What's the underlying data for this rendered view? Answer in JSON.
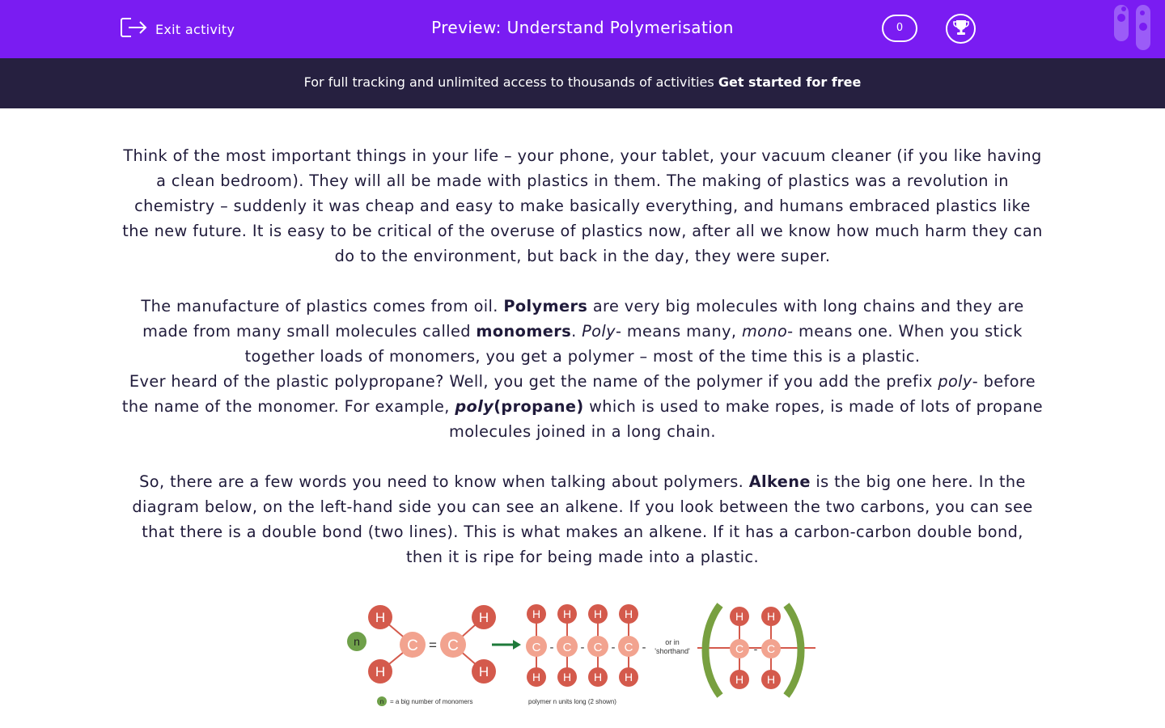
{
  "header": {
    "exit_label": "Exit activity",
    "title": "Preview: Understand Polymerisation",
    "score": "0",
    "bg_color": "#7a1cf2"
  },
  "banner": {
    "text": "For full tracking and unlimited access to thousands of activities ",
    "cta": "Get started for free"
  },
  "content": {
    "p1": "Think of the most important things in your life – your phone, your tablet, your vacuum cleaner (if you like having a clean bedroom). They will all be made with plastics in them. The making of plastics was a revolution in chemistry – suddenly it was cheap and easy to make basically everything, and humans embraced plastics like the new future. It is easy to be critical of the overuse of plastics now, after all we know how much harm they can do to the environment, but back in the day, they were super.",
    "p2": {
      "t1": "The manufacture of plastics comes from oil. ",
      "b1": "Polymers",
      "t2": " are very big molecules with long chains and they are made from many small molecules called ",
      "b2": "monomers",
      "t3": ". ",
      "i1": "Poly",
      "t4": "- means many, ",
      "i2": "mono",
      "t5": "- means one. When you stick together loads of monomers, you get a polymer – most of the time this is a plastic."
    },
    "p3": {
      "t1": "Ever heard of the plastic polypropane? Well, you get the name of the polymer if you add the prefix ",
      "i1": "poly",
      "t2": "- before the name of the monomer. For example, ",
      "bi1": "poly",
      "b1": "(propane)",
      "t3": " which is used to make ropes, is made of lots of propane molecules joined in a long chain."
    },
    "p4": {
      "t1": "So, there are a few words you need to know when talking about polymers. ",
      "b1": "Alkene",
      "t2": " is the big one here. In the diagram below, on the left-hand side you can see an alkene. If you look between the two carbons, you can see that there is a double bond (two lines). This is what makes an alkene. If it has a carbon-carbon double bond, then it is ripe for being made into a plastic."
    }
  },
  "diagram": {
    "n_label": "n",
    "h": "H",
    "c": "C",
    "double_bond": "=",
    "bond": "-",
    "shorthand_line1": "or in",
    "shorthand_line2": "'shorthand'",
    "legend_n": "n",
    "legend_text": "= a big number of monomers",
    "polymer_caption": "polymer n units long (2 shown)",
    "colors": {
      "h": "#d45a4c",
      "c": "#f2a38f",
      "n": "#6fa04a",
      "bracket": "#78a040",
      "arrow": "#1e7a3a"
    }
  }
}
